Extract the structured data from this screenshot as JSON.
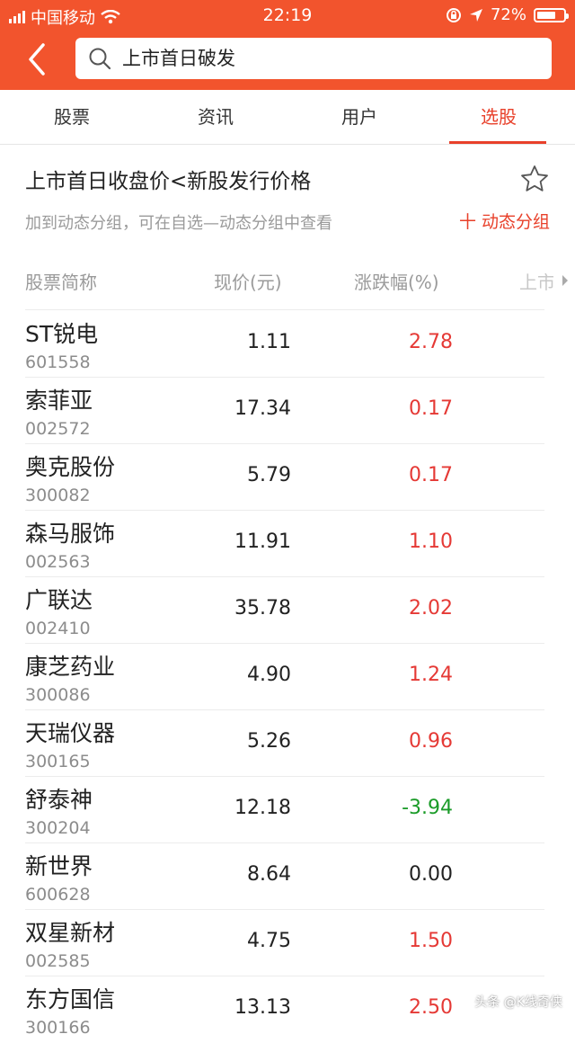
{
  "status_bar": {
    "carrier": "中国移动",
    "time": "22:19",
    "battery": "72%",
    "battery_level": 0.72
  },
  "search": {
    "query": "上市首日破发"
  },
  "tabs": [
    {
      "label": "股票"
    },
    {
      "label": "资讯"
    },
    {
      "label": "用户"
    },
    {
      "label": "选股",
      "active": true
    }
  ],
  "strategy": {
    "title": "上市首日收盘价<新股发行价格",
    "subtitle": "加到动态分组，可在自选—动态分组中查看",
    "add_group_label": "十 动态分组"
  },
  "table": {
    "columns": [
      "股票简称",
      "现价(元)",
      "涨跌幅(%)",
      "上市"
    ],
    "rows": [
      {
        "name": "ST锐电",
        "code": "601558",
        "price": "1.11",
        "change": "2.78",
        "direction": "up"
      },
      {
        "name": "索菲亚",
        "code": "002572",
        "price": "17.34",
        "change": "0.17",
        "direction": "up"
      },
      {
        "name": "奥克股份",
        "code": "300082",
        "price": "5.79",
        "change": "0.17",
        "direction": "up"
      },
      {
        "name": "森马服饰",
        "code": "002563",
        "price": "11.91",
        "change": "1.10",
        "direction": "up"
      },
      {
        "name": "广联达",
        "code": "002410",
        "price": "35.78",
        "change": "2.02",
        "direction": "up"
      },
      {
        "name": "康芝药业",
        "code": "300086",
        "price": "4.90",
        "change": "1.24",
        "direction": "up"
      },
      {
        "name": "天瑞仪器",
        "code": "300165",
        "price": "5.26",
        "change": "0.96",
        "direction": "up"
      },
      {
        "name": "舒泰神",
        "code": "300204",
        "price": "12.18",
        "change": "-3.94",
        "direction": "down"
      },
      {
        "name": "新世界",
        "code": "600628",
        "price": "8.64",
        "change": "0.00",
        "direction": "flat"
      },
      {
        "name": "双星新材",
        "code": "002585",
        "price": "4.75",
        "change": "1.50",
        "direction": "up"
      },
      {
        "name": "东方国信",
        "code": "300166",
        "price": "13.13",
        "change": "2.50",
        "direction": "up"
      }
    ]
  },
  "colors": {
    "brand": "#f2542d",
    "accent": "#e8402a",
    "up": "#e53935",
    "down": "#1a9b28"
  },
  "watermark": "头条 @K线奇侠"
}
